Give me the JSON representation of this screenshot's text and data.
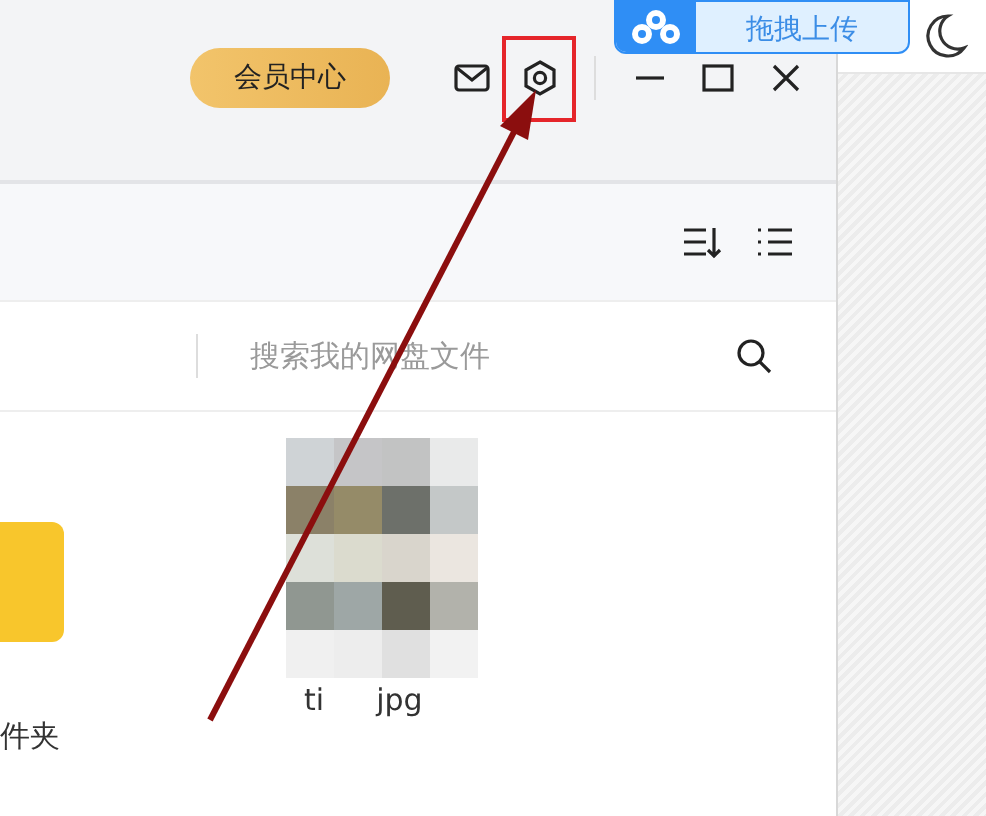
{
  "upload_widget": {
    "label": "拖拽上传"
  },
  "title_bar": {
    "member_button": "会员中心"
  },
  "search": {
    "placeholder": "搜索我的网盘文件"
  },
  "files": [
    {
      "kind": "folder",
      "name": "件夹"
    },
    {
      "name_parts": [
        "ti",
        "jpg"
      ]
    }
  ]
}
